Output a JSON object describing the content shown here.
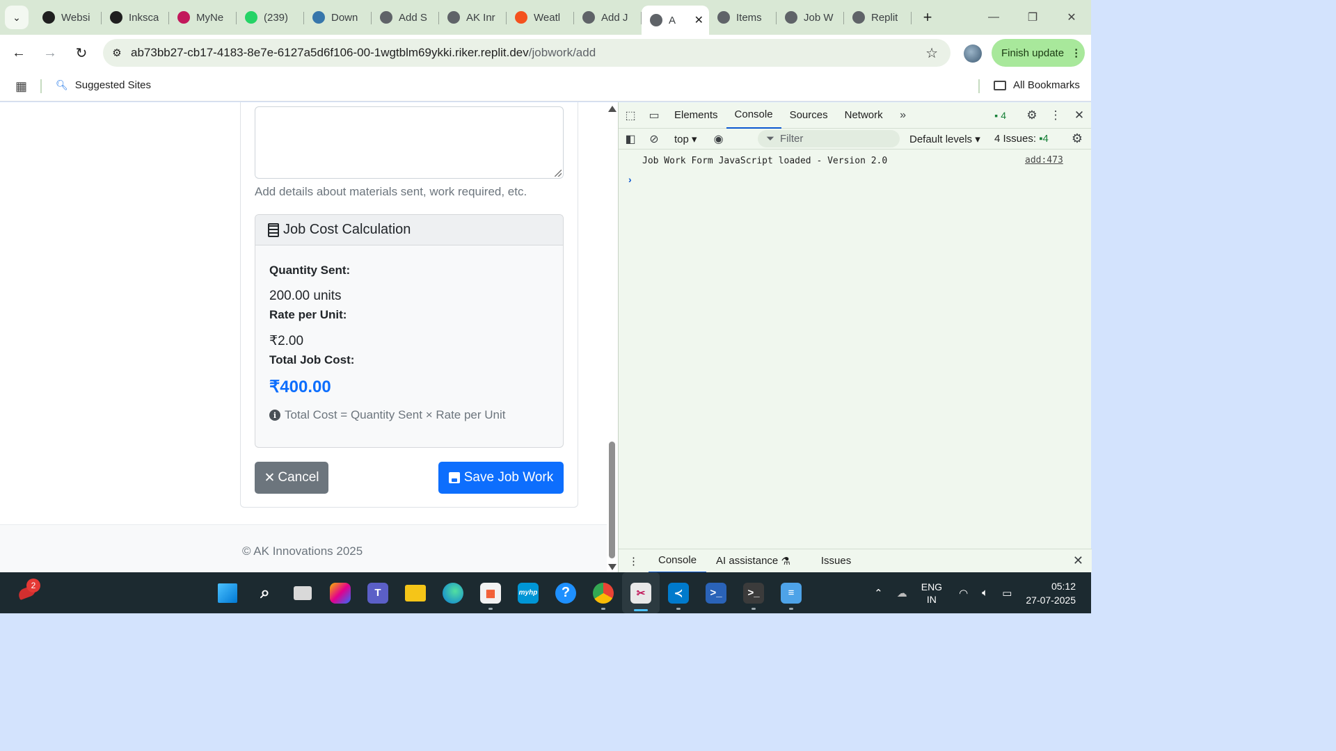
{
  "browser": {
    "tabs": [
      {
        "title": "Websi",
        "icon": "openai-icon",
        "color": "#1f1f1f"
      },
      {
        "title": "Inksca",
        "icon": "inkscape-icon",
        "color": "#1f1f1f"
      },
      {
        "title": "MyNe",
        "icon": "myne-icon",
        "color": "#c2185b"
      },
      {
        "title": "(239)",
        "icon": "whatsapp-icon",
        "color": "#25d366"
      },
      {
        "title": "Down",
        "icon": "python-icon",
        "color": "#3776ab"
      },
      {
        "title": "Add S",
        "icon": "globe-icon",
        "color": "#5f6368"
      },
      {
        "title": "AK Inr",
        "icon": "globe-icon",
        "color": "#5f6368"
      },
      {
        "title": "Weatl",
        "icon": "weather-icon",
        "color": "#f4511e"
      },
      {
        "title": "Add J",
        "icon": "globe-icon",
        "color": "#5f6368"
      },
      {
        "title": "A",
        "icon": "globe-icon",
        "color": "#5f6368",
        "active": true
      },
      {
        "title": "Items",
        "icon": "globe-icon",
        "color": "#5f6368"
      },
      {
        "title": "Job W",
        "icon": "globe-icon",
        "color": "#5f6368"
      },
      {
        "title": "Replit",
        "icon": "loading-icon",
        "color": "#5f6368"
      }
    ],
    "url_main": "ab73bb27-cb17-4183-8e7e-6127a5d6f106-00-1wgtblm69ykki.riker.replit.dev",
    "url_path": "/jobwork/add",
    "finish_update": "Finish update",
    "bookmarks": {
      "suggested": "Suggested Sites",
      "all": "All Bookmarks"
    }
  },
  "page": {
    "help_text": "Add details about materials sent, work required, etc.",
    "cost_card": {
      "title": "Job Cost Calculation",
      "quantity_label": "Quantity Sent:",
      "quantity_value": "200.00 units",
      "rate_label": "Rate per Unit:",
      "rate_value": "₹2.00",
      "total_label": "Total Job Cost:",
      "total_value": "₹400.00",
      "formula": "Total Cost = Quantity Sent × Rate per Unit"
    },
    "buttons": {
      "cancel": "Cancel",
      "save": "Save Job Work"
    },
    "footer": "© AK Innovations 2025",
    "accent_color": "#0d6efd"
  },
  "devtools": {
    "tabs": [
      "Elements",
      "Console",
      "Sources",
      "Network"
    ],
    "active_tab": "Console",
    "message_count": "4",
    "context": "top",
    "filter_placeholder": "Filter",
    "levels": "Default levels",
    "issues_label": "4 Issues:",
    "issues_count": "4",
    "console_message": "Job Work Form JavaScript loaded - Version 2.0",
    "console_source": "add:473",
    "drawer_tabs": [
      "Console",
      "AI assistance",
      "Issues"
    ]
  },
  "taskbar": {
    "notification_badge": "2",
    "language_line1": "ENG",
    "language_line2": "IN",
    "time": "05:12",
    "date": "27-07-2025"
  }
}
